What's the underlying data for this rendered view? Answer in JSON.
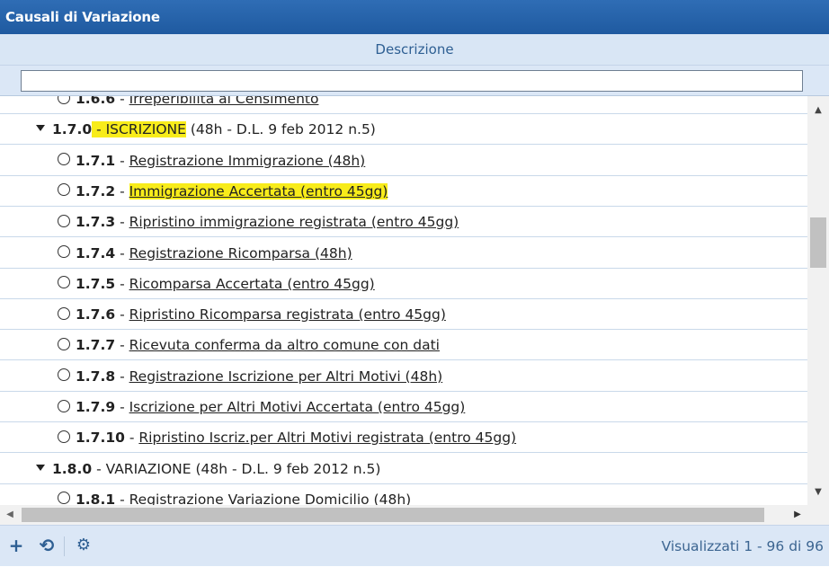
{
  "window": {
    "title": "Causali di Variazione"
  },
  "grid": {
    "column_header": "Descrizione",
    "filter_value": "",
    "rows": [
      {
        "kind": "leaf",
        "code": "1.6.6",
        "label": "Irreperibilità al Censimento",
        "highlight": false
      },
      {
        "kind": "group",
        "code": "1.7.0",
        "name": "ISCRIZIONE",
        "suffix": " (48h - D.L. 9 feb 2012 n.5)",
        "highlight": true
      },
      {
        "kind": "leaf",
        "code": "1.7.1",
        "label": "Registrazione Immigrazione (48h)",
        "highlight": false
      },
      {
        "kind": "leaf",
        "code": "1.7.2",
        "label": "Immigrazione Accertata (entro 45gg)",
        "highlight": true
      },
      {
        "kind": "leaf",
        "code": "1.7.3",
        "label": "Ripristino immigrazione registrata (entro 45gg)",
        "highlight": false
      },
      {
        "kind": "leaf",
        "code": "1.7.4",
        "label": "Registrazione Ricomparsa (48h)",
        "highlight": false
      },
      {
        "kind": "leaf",
        "code": "1.7.5",
        "label": "Ricomparsa Accertata (entro 45gg)",
        "highlight": false
      },
      {
        "kind": "leaf",
        "code": "1.7.6",
        "label": "Ripristino Ricomparsa registrata (entro 45gg)",
        "highlight": false
      },
      {
        "kind": "leaf",
        "code": "1.7.7",
        "label": "Ricevuta conferma da altro comune con dati",
        "highlight": false
      },
      {
        "kind": "leaf",
        "code": "1.7.8",
        "label": "Registrazione Iscrizione per Altri Motivi (48h)",
        "highlight": false
      },
      {
        "kind": "leaf",
        "code": "1.7.9",
        "label": "Iscrizione per Altri Motivi Accertata (entro 45gg)",
        "highlight": false
      },
      {
        "kind": "leaf",
        "code": "1.7.10",
        "label": "Ripristino Iscriz.per Altri Motivi registrata (entro 45gg)",
        "highlight": false
      },
      {
        "kind": "group",
        "code": "1.8.0",
        "name": "VARIAZIONE",
        "suffix": " (48h - D.L. 9 feb 2012 n.5)",
        "highlight": false
      },
      {
        "kind": "leaf",
        "code": "1.8.1",
        "label": "Registrazione Variazione Domicilio (48h)",
        "highlight": false
      }
    ]
  },
  "footer": {
    "status": "Visualizzati 1 - 96 di 96",
    "buttons": [
      {
        "icon": "plus-icon",
        "glyph": "+"
      },
      {
        "icon": "refresh-icon",
        "glyph": "⟲"
      },
      {
        "icon": "gear-icon",
        "glyph": "⚙"
      }
    ]
  },
  "colors": {
    "title_bar": "#2160a8",
    "header_bg": "#d9e6f5",
    "highlight": "#f8ec1a",
    "row_border": "#c9d9ea"
  }
}
